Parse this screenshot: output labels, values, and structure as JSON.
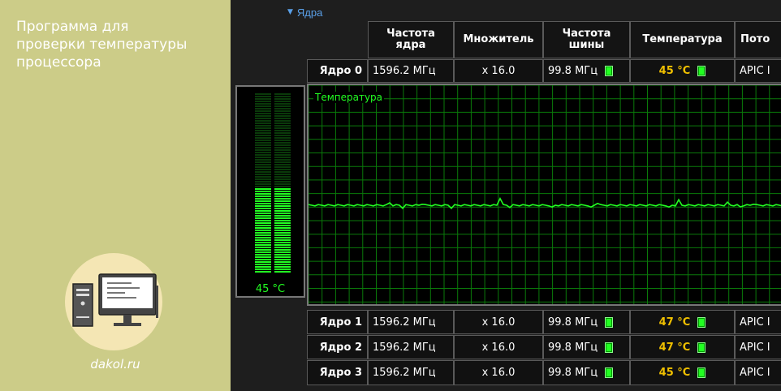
{
  "promo": {
    "title_lines": [
      "Программа для",
      "проверки температуры",
      "процессора"
    ],
    "site": "dakol.ru"
  },
  "tree": {
    "label": "Ядра",
    "arrow": "▼"
  },
  "table": {
    "headers": [
      [
        "Частота",
        "ядра"
      ],
      [
        "Множитель"
      ],
      [
        "Частота",
        "шины"
      ],
      [
        "Температура"
      ],
      [
        "Пото"
      ]
    ],
    "rows": [
      {
        "core": "Ядро 0",
        "freq": "1596.2 МГц",
        "mult": "x 16.0",
        "bus": "99.8 МГц",
        "temp": "45 °C",
        "apic": "APIC I"
      },
      {
        "core": "Ядро 1",
        "freq": "1596.2 МГц",
        "mult": "x 16.0",
        "bus": "99.8 МГц",
        "temp": "47 °C",
        "apic": "APIC I"
      },
      {
        "core": "Ядро 2",
        "freq": "1596.2 МГц",
        "mult": "x 16.0",
        "bus": "99.8 МГц",
        "temp": "47 °C",
        "apic": "APIC I"
      },
      {
        "core": "Ядро 3",
        "freq": "1596.2 МГц",
        "mult": "x 16.0",
        "bus": "99.8 МГц",
        "temp": "45 °C",
        "apic": "APIC I"
      }
    ]
  },
  "graph": {
    "label": "Температура",
    "line_color": "#22ff22",
    "grid_color": "#0a7a0a"
  },
  "meter": {
    "value": "45 °C",
    "level": 0.48,
    "on_color": "#22ff22",
    "off_color": "#0a3a0a"
  },
  "colors": {
    "promo_bg": "#cccc88",
    "temp_text": "#f0c000",
    "tree_text": "#5aa0e8"
  }
}
